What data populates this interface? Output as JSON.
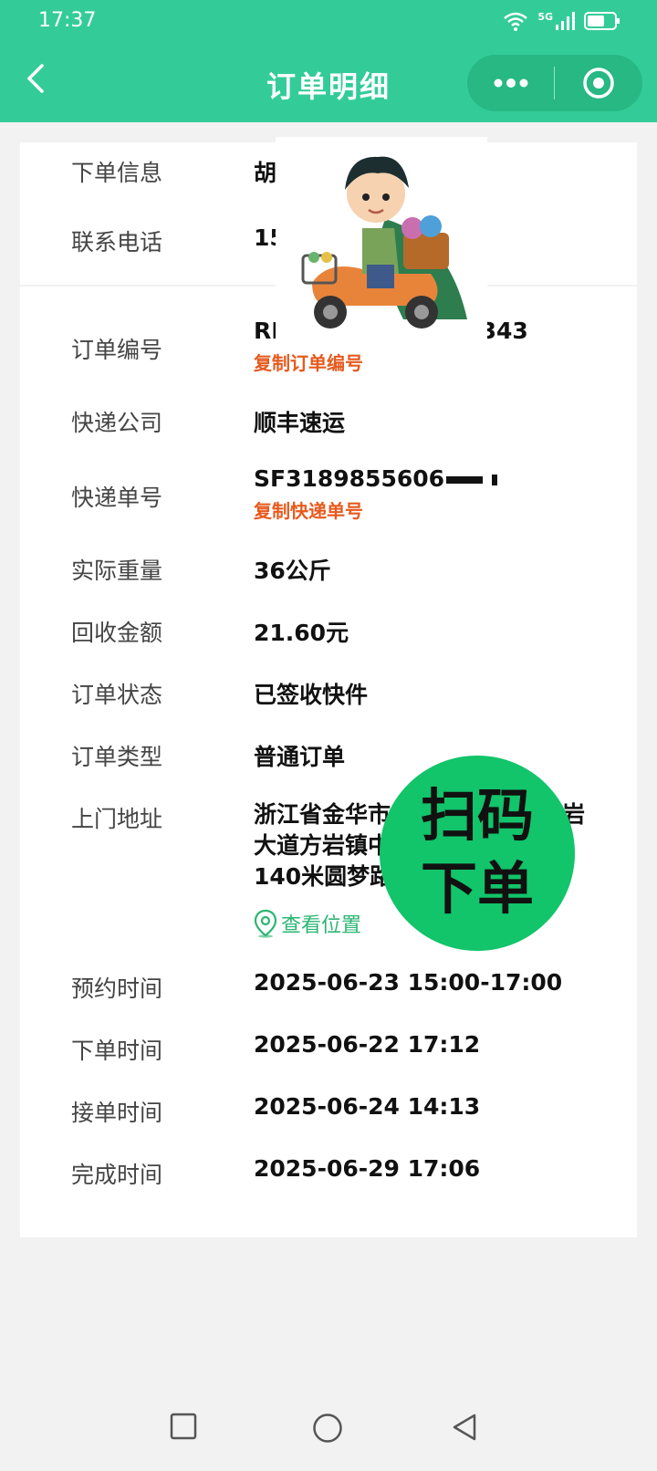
{
  "status": {
    "time": "17:37",
    "signal": "5G"
  },
  "nav": {
    "title": "订单明细"
  },
  "card1": [
    {
      "label": "下单信息",
      "value": "胡"
    },
    {
      "label": "联系电话",
      "value": "15"
    }
  ],
  "order": {
    "number_label": "订单编号",
    "number_value": "RL",
    "number_suffix": "3343",
    "number_copy": "复制订单编号",
    "company_label": "快递公司",
    "company_value": "顺丰速运",
    "tracking_label": "快递单号",
    "tracking_value": "SF3189855606",
    "tracking_copy": "复制快递单号",
    "weight_label": "实际重量",
    "weight_value": "36公斤",
    "amount_label": "回收金额",
    "amount_value": "21.60元",
    "status_label": "订单状态",
    "status_value": "已签收快件",
    "type_label": "订单类型",
    "type_value": "普通订单",
    "address_label": "上门地址",
    "address_line1": "浙江省金华市",
    "address_line1_tail": "岩",
    "address_line2": "大道方岩镇中",
    "address_line3": "140米圆梦路",
    "view_location": "查看位置",
    "appoint_label": "预约时间",
    "appoint_value": "2025-06-23 15:00-17:00",
    "placed_label": "下单时间",
    "placed_value": "2025-06-22 17:12",
    "accepted_label": "接单时间",
    "accepted_value": "2025-06-24 14:13",
    "finished_label": "完成时间",
    "finished_value": "2025-06-29 17:06"
  },
  "badge": {
    "line1": "扫码",
    "line2": "下单"
  },
  "colors": {
    "brand": "#33cc99",
    "copy": "#e65a1e",
    "location": "#2bb673",
    "badge": "#12c46a"
  }
}
